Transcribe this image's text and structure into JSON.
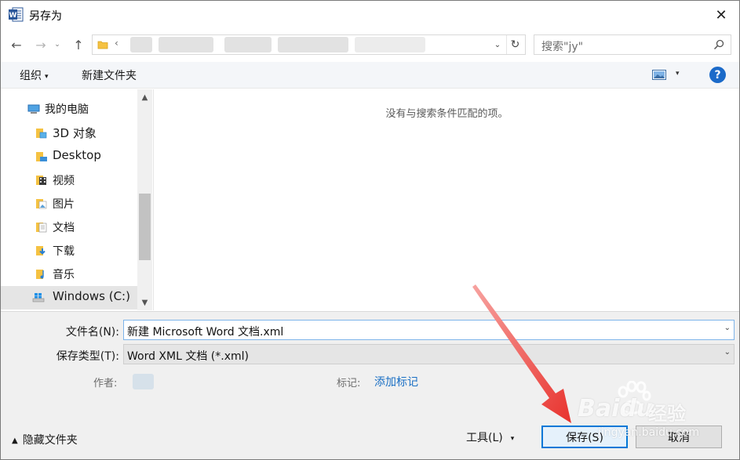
{
  "window": {
    "title": "另存为",
    "close_glyph": "✕"
  },
  "nav_buttons": {
    "back": "←",
    "forward": "→",
    "recent": "⌄",
    "up": "↑"
  },
  "address": {
    "separator": "‹",
    "dropdown": "⌄",
    "refresh": "↻"
  },
  "search": {
    "placeholder": "搜索\"jy\""
  },
  "toolbar": {
    "organize_label": "组织",
    "new_folder_label": "新建文件夹",
    "help_label": "?",
    "caret": "▾"
  },
  "nav_pane": {
    "items": [
      {
        "label": "我的电脑",
        "icon": "computer-icon"
      },
      {
        "label": "3D 对象",
        "icon": "3d-objects-icon"
      },
      {
        "label": "Desktop",
        "icon": "desktop-folder-icon"
      },
      {
        "label": "视频",
        "icon": "videos-folder-icon"
      },
      {
        "label": "图片",
        "icon": "pictures-folder-icon"
      },
      {
        "label": "文档",
        "icon": "documents-folder-icon"
      },
      {
        "label": "下载",
        "icon": "downloads-folder-icon"
      },
      {
        "label": "音乐",
        "icon": "music-folder-icon"
      },
      {
        "label": "Windows (C:)",
        "icon": "drive-icon"
      }
    ],
    "scroll_up": "▲",
    "scroll_down": "▼"
  },
  "content": {
    "empty_message": "没有与搜索条件匹配的项。"
  },
  "form": {
    "filename_label": "文件名(N):",
    "filename_value": "新建 Microsoft Word 文档.xml",
    "filetype_label": "保存类型(T):",
    "filetype_value": "Word XML 文档 (*.xml)",
    "dropdown_glyph": "⌄",
    "author_label": "作者:",
    "tags_label": "标记:",
    "tags_link": "添加标记"
  },
  "footer": {
    "hide_folders_label": "隐藏文件夹",
    "hide_chevron": "▲",
    "tools_label": "工具(L)",
    "tools_caret": "▾",
    "save_label": "保存(S)",
    "cancel_label": "取消"
  },
  "watermark": {
    "brand": "Baidu",
    "brand_suffix": "经验",
    "url": "jingyan.baidu.com"
  },
  "colors": {
    "accent": "#0078d7",
    "help": "#1b6ac9",
    "arrow": "#e8322d",
    "link": "#1a6fc4"
  }
}
